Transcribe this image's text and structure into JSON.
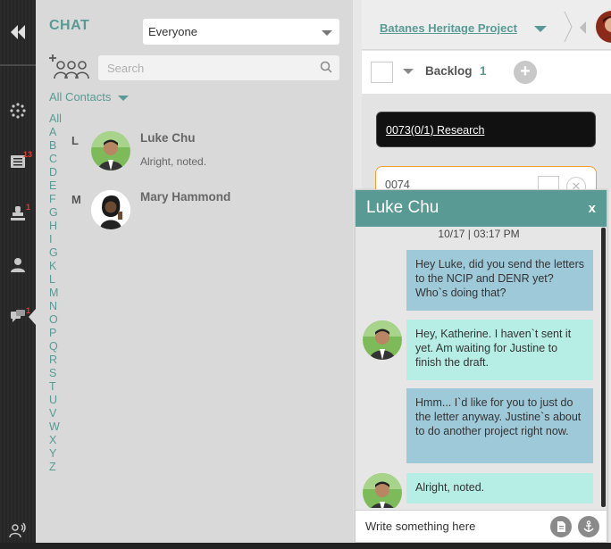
{
  "chat_panel": {
    "title": "CHAT",
    "audience_select": "Everyone",
    "search_placeholder": "Search",
    "filter_label": "All Contacts",
    "alphabet": [
      "All",
      "A",
      "B",
      "C",
      "D",
      "E",
      "F",
      "G",
      "H",
      "I",
      "G",
      "K",
      "L",
      "M",
      "N",
      "O",
      "P",
      "Q",
      "R",
      "S",
      "T",
      "U",
      "V",
      "W",
      "X",
      "Y",
      "Z"
    ],
    "contacts": [
      {
        "group": "L",
        "name": "Luke Chu",
        "preview": "Alright, noted."
      },
      {
        "group": "M",
        "name": "Mary Hammond",
        "preview": ""
      }
    ]
  },
  "rail": {
    "badges": {
      "tasks": "13",
      "approvals": "1",
      "chat": "1"
    }
  },
  "project": {
    "title": "Batanes Heritage Project",
    "backlog_label": "Backlog",
    "backlog_count": "1",
    "cards": [
      {
        "label": "0073(0/1) Research"
      },
      {
        "label": "0074"
      }
    ]
  },
  "chat_window": {
    "contact_name": "Luke Chu",
    "close_label": "x",
    "timestamp": "10/17 | 03:17 PM",
    "messages": [
      {
        "direction": "out",
        "text": "Hey Luke, did you send the letters to the NCIP and DENR yet? Who`s doing that?"
      },
      {
        "direction": "in",
        "text": "Hey, Katherine. I haven`t sent it yet. Am waiting for Justine to finish the draft."
      },
      {
        "direction": "out",
        "text": "Hmm... I`d like for you to just do the letter anyway. Justine`s about to do another project right now."
      },
      {
        "direction": "in",
        "text": "Alright, noted."
      }
    ],
    "input_placeholder": "Write something here"
  },
  "colors": {
    "accent": "#5a9a94",
    "outgoing_bubble": "#9ec9d9",
    "incoming_bubble": "#b6eee6",
    "badge": "#e53935"
  }
}
